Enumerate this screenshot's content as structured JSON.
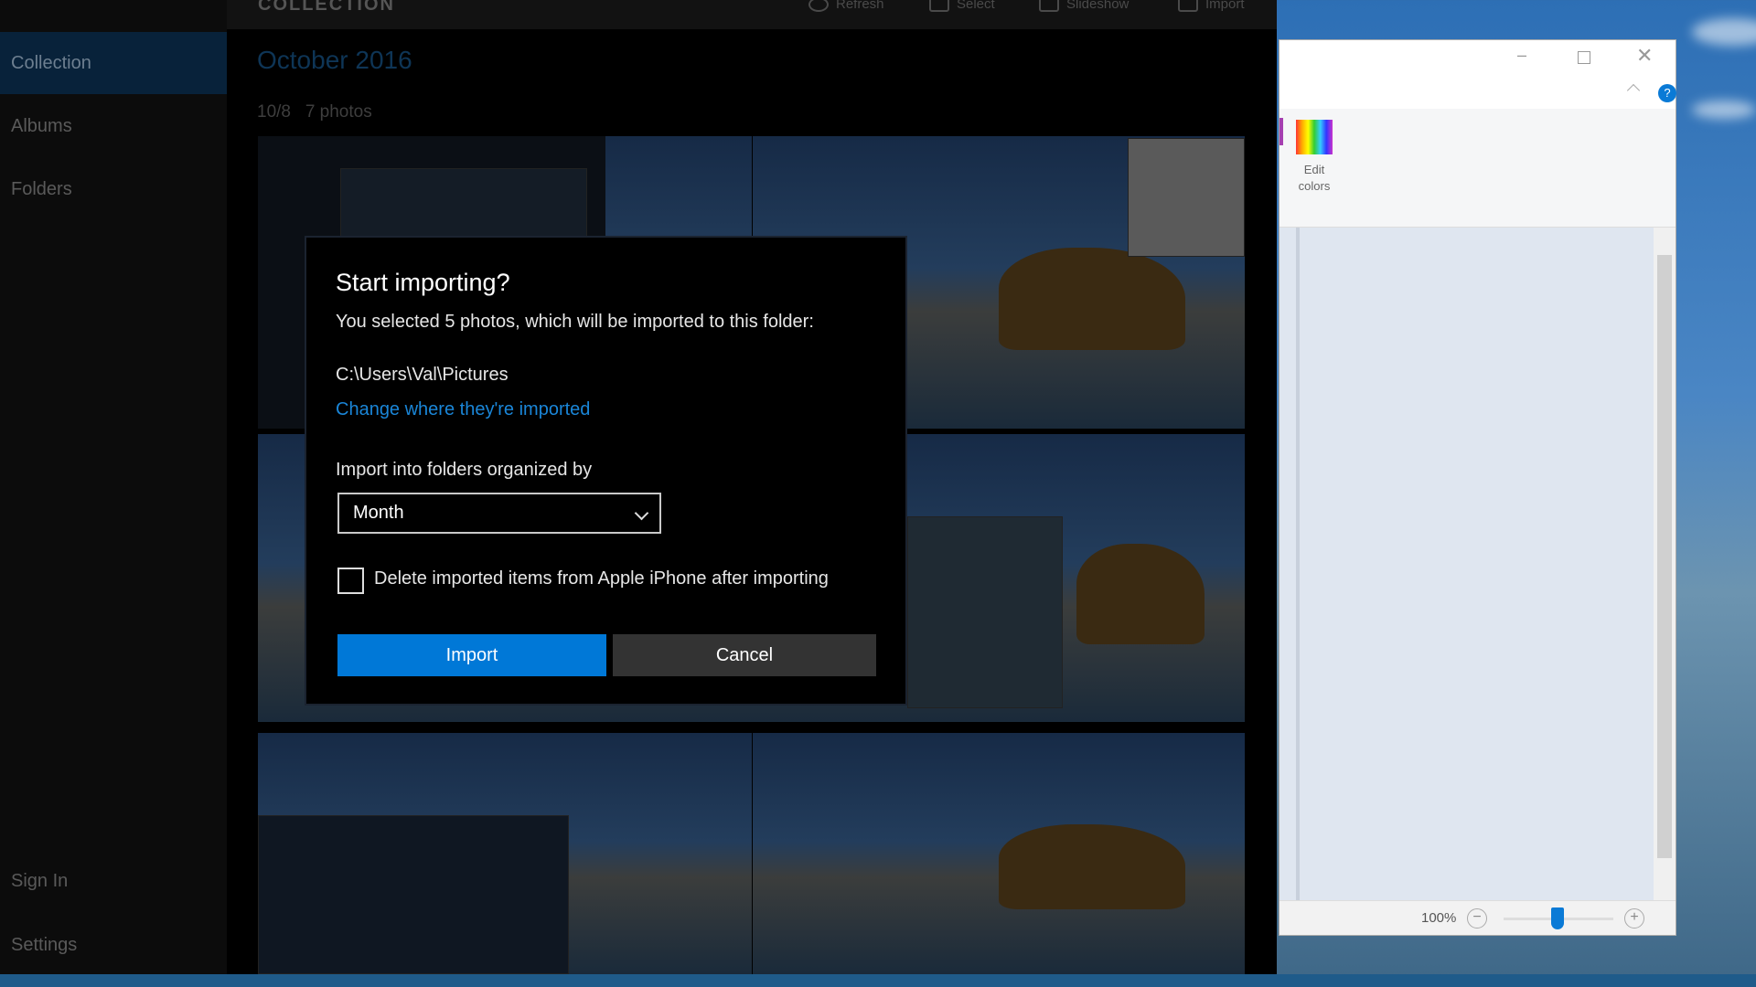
{
  "photos_app": {
    "header_title": "COLLECTION",
    "toolbar": [
      {
        "label": "Refresh",
        "icon": "refresh-icon"
      },
      {
        "label": "Select",
        "icon": "select-icon"
      },
      {
        "label": "Slideshow",
        "icon": "slideshow-icon"
      },
      {
        "label": "Import",
        "icon": "import-icon"
      }
    ],
    "nav": {
      "items": [
        "Collection",
        "Albums",
        "Folders"
      ],
      "active": "Collection",
      "bottom": [
        "Sign In",
        "Settings"
      ]
    },
    "group_title": "October 2016",
    "group_date": "10/8",
    "group_count": "7 photos"
  },
  "dialog": {
    "title": "Start importing?",
    "message": "You selected 5 photos, which will be imported to this folder:",
    "path": "C:\\Users\\Val\\Pictures",
    "change_link": "Change where they're imported",
    "organize_label": "Import into folders organized by",
    "organize_value": "Month",
    "delete_label": "Delete imported items from Apple iPhone after importing",
    "delete_checked": false,
    "import_label": "Import",
    "cancel_label": "Cancel",
    "accent": "#0078d7"
  },
  "paint": {
    "edit_colors": "Edit colors",
    "zoom": "100%",
    "zoom_percent": 100
  }
}
